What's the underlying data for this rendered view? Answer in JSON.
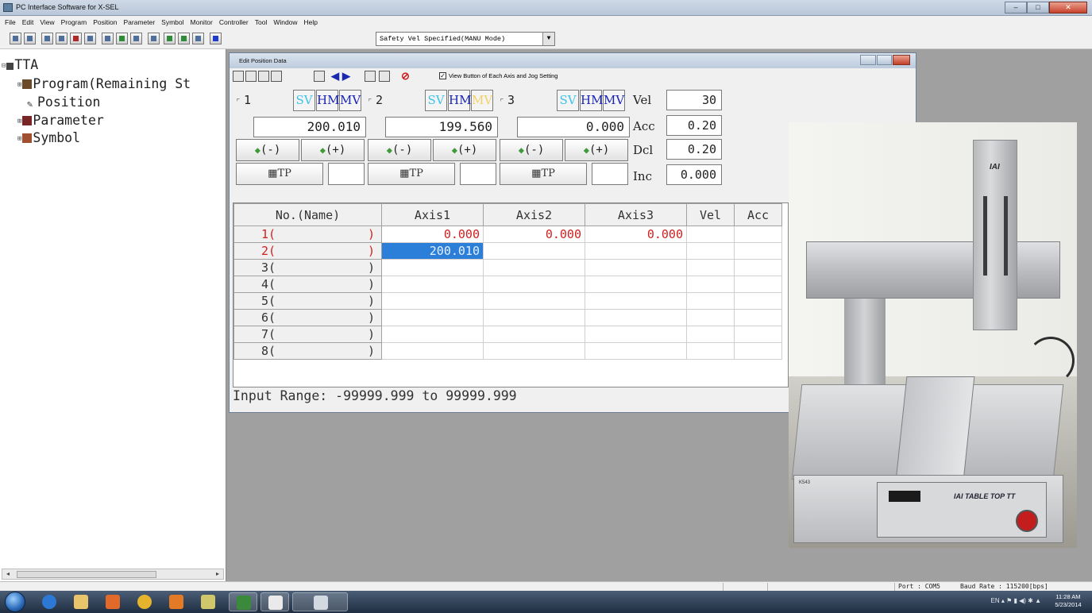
{
  "app": {
    "title": "PC Interface Software for X-SEL"
  },
  "menu": [
    "File",
    "Edit",
    "View",
    "Program",
    "Position",
    "Parameter",
    "Symbol",
    "Monitor",
    "Controller",
    "Tool",
    "Window",
    "Help"
  ],
  "toolbar": {
    "mode_select": "Safety Vel Specified(MANU Mode)"
  },
  "tree": {
    "root": "TTA",
    "items": [
      {
        "label": "Program(Remaining St",
        "icon": "program-icon",
        "expand": "+"
      },
      {
        "label": "Position",
        "icon": "pencil-icon",
        "expand": ""
      },
      {
        "label": "Parameter",
        "icon": "parameter-icon",
        "expand": "+"
      },
      {
        "label": "Symbol",
        "icon": "symbol-icon",
        "expand": "+"
      }
    ]
  },
  "edit_window": {
    "title": "Edit Position Data",
    "view_checkbox": "View Button of Each Axis and Jog Setting",
    "axes": [
      {
        "num": "1",
        "value": "200.010",
        "sv": "SV",
        "hm": "HM",
        "mv": "MV",
        "jog_minus": "(-)",
        "jog_plus": "(+)",
        "tp": "TP"
      },
      {
        "num": "2",
        "value": "199.560",
        "sv": "SV",
        "hm": "HM",
        "mv": "MV",
        "jog_minus": "(-)",
        "jog_plus": "(+)",
        "tp": "TP"
      },
      {
        "num": "3",
        "value": "0.000",
        "sv": "SV",
        "hm": "HM",
        "mv": "MV",
        "jog_minus": "(-)",
        "jog_plus": "(+)",
        "tp": "TP"
      }
    ],
    "params": [
      {
        "label": "Vel",
        "value": "30"
      },
      {
        "label": "Acc",
        "value": "0.20"
      },
      {
        "label": "Dcl",
        "value": "0.20"
      },
      {
        "label": "Inc",
        "value": "0.000"
      }
    ],
    "grid": {
      "headers": [
        "No.(Name)",
        "Axis1",
        "Axis2",
        "Axis3",
        "Vel",
        "Acc"
      ],
      "rows": [
        {
          "no": "1(",
          "close": ")",
          "axis1": "0.000",
          "axis2": "0.000",
          "axis3": "0.000"
        },
        {
          "no": "2(",
          "close": ")",
          "axis1": "200.010",
          "axis2": "",
          "axis3": ""
        },
        {
          "no": "3(",
          "close": ")",
          "axis1": "",
          "axis2": "",
          "axis3": ""
        },
        {
          "no": "4(",
          "close": ")",
          "axis1": "",
          "axis2": "",
          "axis3": ""
        },
        {
          "no": "5(",
          "close": ")",
          "axis1": "",
          "axis2": "",
          "axis3": ""
        },
        {
          "no": "6(",
          "close": ")",
          "axis1": "",
          "axis2": "",
          "axis3": ""
        },
        {
          "no": "7(",
          "close": ")",
          "axis1": "",
          "axis2": "",
          "axis3": ""
        },
        {
          "no": "8(",
          "close": ")",
          "axis1": "",
          "axis2": "",
          "axis3": ""
        }
      ]
    },
    "input_range": "Input Range: -99999.999 to 99999.999"
  },
  "photo": {
    "column_logo": "IAI",
    "panel_label": "IAI TABLE TOP TT",
    "model": "K543"
  },
  "statusbar": {
    "port": "Port : COM5",
    "baud": "Baud Rate : 115200[bps]"
  },
  "taskbar": {
    "lang": "EN",
    "time": "11:28 AM",
    "date": "5/23/2014"
  }
}
